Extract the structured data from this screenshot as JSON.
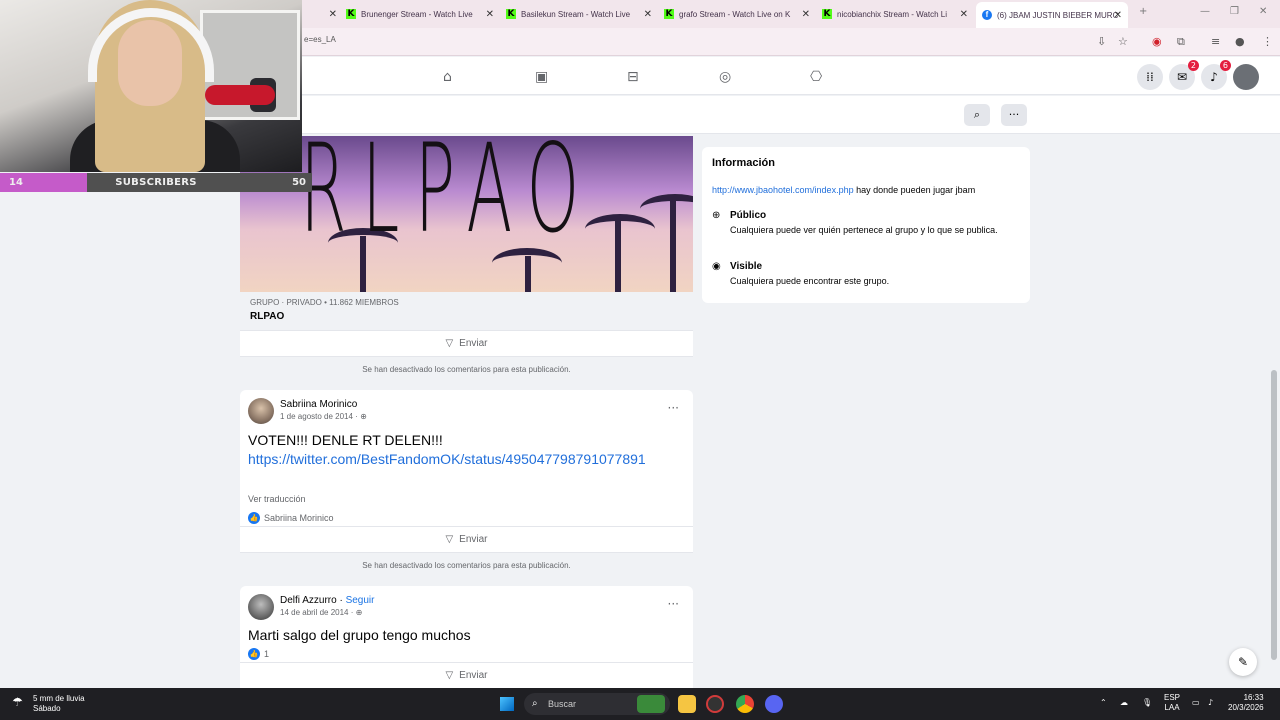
{
  "browser": {
    "tabs": [
      {
        "label": "Brunenger Stream - Watch Live"
      },
      {
        "label": "Basilekun Stream - Watch Live"
      },
      {
        "label": "grafo Stream - Watch Live on K"
      },
      {
        "label": "nicobianchix Stream - Watch Li"
      },
      {
        "label": "(6) JBAM JUSTIN BIEBER MURC"
      }
    ],
    "address_fragment": "e=es_LA"
  },
  "overlay": {
    "subs_current": "14",
    "subs_label": "SUBSCRIBERS",
    "subs_goal": "50",
    "subs_progress": 0.28
  },
  "header": {
    "messenger_badge": "2",
    "notifications_badge": "6"
  },
  "group": {
    "cover_text": "RLPAO",
    "meta_line": "GRUPO · PRIVADO • 11.862 MIEMBROS",
    "name": "RLPAO",
    "send_label": "Enviar",
    "comments_disabled": "Se han desactivado los comentarios para esta publicación."
  },
  "info": {
    "title": "Información",
    "link": "http://www.jbaohotel.com/index.php",
    "desc_rest": " hay donde pueden jugar jbam",
    "public_title": "Público",
    "public_desc": "Cualquiera puede ver quién pertenece al grupo y lo que se publica.",
    "visible_title": "Visible",
    "visible_desc": "Cualquiera puede encontrar este grupo."
  },
  "posts": [
    {
      "author": "Sabriina Morinico",
      "date": "1 de agosto de 2014 ·",
      "text": "VOTEN!!! DENLE RT DELEN!!!",
      "link": "https://twitter.com/BestFandomOK/status/495047798791077891",
      "translate": "Ver traducción",
      "likes": "Sabriina Morinico",
      "send_label": "Enviar",
      "comments_disabled": "Se han desactivado los comentarios para esta publicación."
    },
    {
      "author": "Delfi Azzurro",
      "follow": "Seguir",
      "date": "14 de abril de 2014 ·",
      "text": "Marti salgo del grupo tengo muchos",
      "likes": "1",
      "send_label": "Enviar"
    }
  ],
  "taskbar": {
    "weather_line1": "5 mm de lluvia",
    "weather_line2": "Sábado",
    "search_placeholder": "Buscar",
    "lang_line1": "ESP",
    "lang_line2": "LAA",
    "time": "16:33",
    "date": "20/3/2026"
  }
}
